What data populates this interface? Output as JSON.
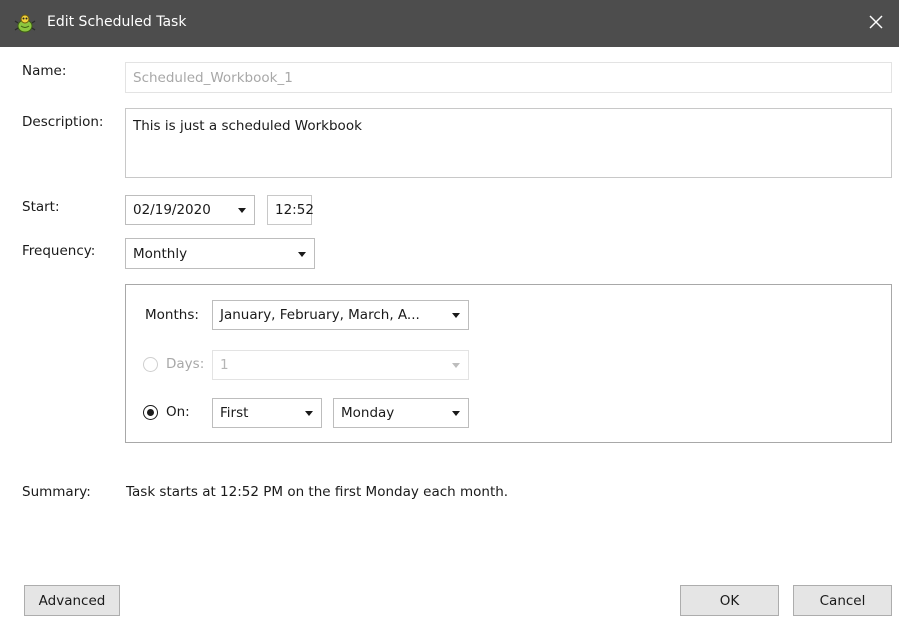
{
  "window": {
    "title": "Edit Scheduled Task",
    "icon": "app-bug-icon",
    "close_glyph": "✕"
  },
  "labels": {
    "name": "Name:",
    "description": "Description:",
    "start": "Start:",
    "frequency": "Frequency:",
    "summary": "Summary:"
  },
  "form": {
    "name_value": "Scheduled_Workbook_1",
    "description_value": "This is just a scheduled Workbook",
    "start_date": "02/19/2020",
    "start_time": "12:52",
    "frequency": "Monthly"
  },
  "monthly": {
    "months_label": "Months:",
    "months_value": "January, February, March, A...",
    "days_label": "Days:",
    "days_value": "1",
    "days_selected": false,
    "on_label": "On:",
    "on_selected": true,
    "on_ordinal": "First",
    "on_weekday": "Monday"
  },
  "summary_text": "Task starts at 12:52 PM on the first Monday each month.",
  "buttons": {
    "advanced": "Advanced",
    "ok": "OK",
    "cancel": "Cancel"
  },
  "colors": {
    "titlebar": "#4d4d4d",
    "button_face": "#e5e5e5",
    "disabled_text": "#a8a8a8"
  }
}
